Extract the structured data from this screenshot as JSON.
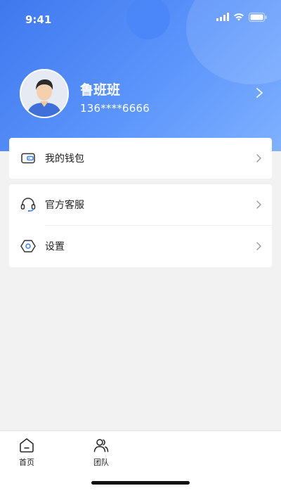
{
  "status_bar": {
    "time": "9:41"
  },
  "profile": {
    "name": "鲁班班",
    "phone": "136****6666"
  },
  "menu": {
    "wallet_label": "我的钱包",
    "service_label": "官方客服",
    "settings_label": "设置"
  },
  "tabbar": {
    "home_label": "首页",
    "team_label": "团队"
  },
  "colors": {
    "header_gradient_start": "#3f78ee",
    "header_gradient_end": "#7fb1ff",
    "background": "#f2f2f2",
    "icon_accent": "#3b82f6"
  }
}
